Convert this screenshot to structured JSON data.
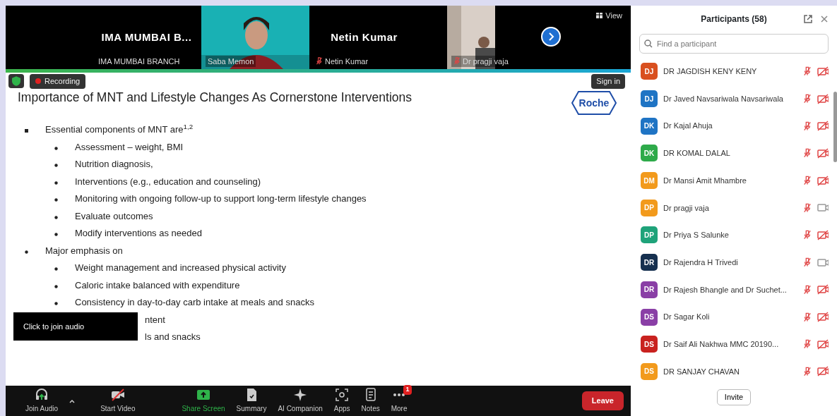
{
  "video_strip": {
    "tiles": [
      {
        "kind": "name",
        "title": "IMA MUMBAI B...",
        "label": "IMA MUMBAI BRANCH"
      },
      {
        "kind": "camera",
        "label": "Saba Memon"
      },
      {
        "kind": "name",
        "title": "Netin Kumar",
        "label": "Netin Kumar",
        "muted": true
      },
      {
        "kind": "camera",
        "label": "Dr pragji vaja",
        "muted": true
      }
    ],
    "view_label": "View"
  },
  "status": {
    "recording_label": "Recording",
    "sign_in": "Sign in"
  },
  "slide": {
    "title": "Importance of MNT and Lifestyle Changes As Cornerstone Interventions",
    "logo": "Roche",
    "items": [
      {
        "text": "Essential components of MNT are$^{1,2}$",
        "children": [
          {
            "text": "Assessment – weight, BMI"
          },
          {
            "text": "Nutrition diagnosis,"
          },
          {
            "text": "Interventions (e.g., education and counseling)"
          },
          {
            "text": "Monitoring with ongoing follow-up to support long-term lifestyle changes"
          },
          {
            "text": "Evaluate outcomes"
          },
          {
            "text": "Modify interventions as needed"
          }
        ]
      },
      {
        "text": "Major emphasis on",
        "children": [
          {
            "text": "Weight management and increased physical activity"
          },
          {
            "text": "Caloric intake balanced with expenditure"
          },
          {
            "text": "Consistency in day-to-day carb intake at meals and snacks"
          },
          {
            "text": "ntent",
            "covered": true
          },
          {
            "text": "ls and snacks",
            "covered": true
          }
        ]
      }
    ]
  },
  "tooltip": "Click to join audio",
  "toolbar": [
    {
      "kind": "audio",
      "label": "Join Audio"
    },
    {
      "kind": "video",
      "label": "Start Video"
    },
    {
      "kind": "share",
      "label": "Share Screen"
    },
    {
      "kind": "summary",
      "label": "Summary"
    },
    {
      "kind": "ai",
      "label": "AI Companion"
    },
    {
      "kind": "apps",
      "label": "Apps"
    },
    {
      "kind": "notes",
      "label": "Notes"
    },
    {
      "kind": "more",
      "label": "More",
      "badge": "1"
    }
  ],
  "leave": "Leave",
  "participants": {
    "title": "Participants (58)",
    "search": {
      "placeholder": "Find a participant"
    },
    "items": [
      {
        "initials": "DJ",
        "name": "DR JAGDISH KENY KENY",
        "color": "#d9501f",
        "muted": true,
        "video_off": true
      },
      {
        "initials": "DJ",
        "name": "Dr Javed Navsariwala Navsariwala",
        "color": "#1f74c4",
        "muted": true,
        "video_off": true
      },
      {
        "initials": "DK",
        "name": "Dr Kajal Ahuja",
        "color": "#1f74c4",
        "muted": true,
        "video_off": true
      },
      {
        "initials": "DK",
        "name": "DR KOMAL DALAL",
        "color": "#2eaa4a",
        "muted": true,
        "video_off": true
      },
      {
        "initials": "DM",
        "name": "Dr Mansi Amit Mhambre",
        "color": "#f29a1c",
        "muted": true,
        "video_off": true
      },
      {
        "initials": "DP",
        "name": "Dr pragji vaja",
        "color": "#f29a1c",
        "muted": true,
        "video_off": false
      },
      {
        "initials": "DP",
        "name": "Dr Priya S Salunke",
        "color": "#1fa37a",
        "muted": true,
        "video_off": true
      },
      {
        "initials": "DR",
        "name": "Dr Rajendra H Trivedi",
        "color": "#16304f",
        "muted": true,
        "video_off": false
      },
      {
        "initials": "DR",
        "name": "Dr Rajesh Bhangle and Dr Suchet...",
        "color": "#8a3fa6",
        "muted": true,
        "video_off": true
      },
      {
        "initials": "DS",
        "name": "Dr Sagar Koli",
        "color": "#8a3fa6",
        "muted": true,
        "video_off": true
      },
      {
        "initials": "DS",
        "name": "Dr Saif Ali Nakhwa MMC 20190...",
        "color": "#c9221f",
        "muted": true,
        "video_off": true
      },
      {
        "initials": "DS",
        "name": "DR SANJAY CHAVAN",
        "color": "#f29a1c",
        "muted": true,
        "video_off": true
      }
    ],
    "invite": "Invite"
  }
}
